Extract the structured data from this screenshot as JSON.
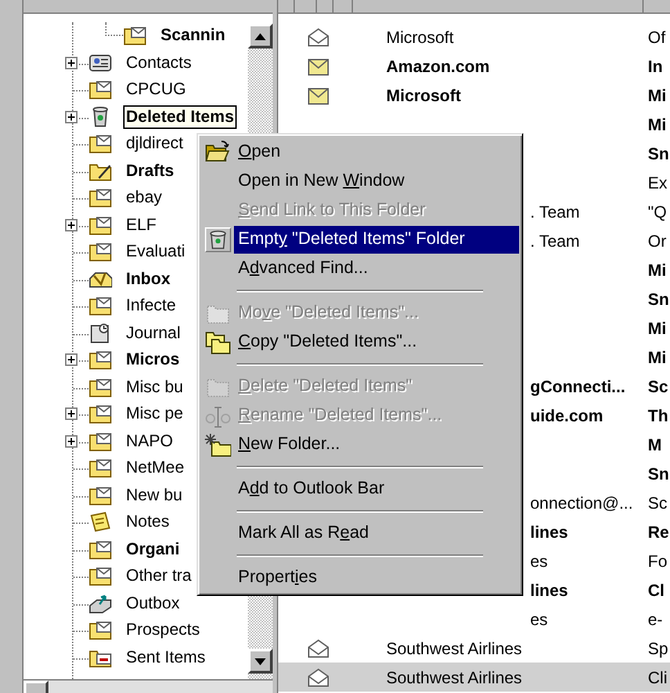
{
  "folder_tree": {
    "items": [
      {
        "children": [
          {
            "label": "Scannin",
            "bold": true,
            "expandable": false,
            "selected": false,
            "kind": "mail"
          }
        ]
      },
      {
        "label": "Contacts",
        "bold": false,
        "expandable": true,
        "selected": false,
        "kind": "contacts"
      },
      {
        "label": "CPCUG",
        "bold": false,
        "expandable": false,
        "selected": false,
        "kind": "mail"
      },
      {
        "label": "Deleted Items",
        "bold": true,
        "expandable": true,
        "selected": true,
        "kind": "trash"
      },
      {
        "label": "djldirect",
        "bold": false,
        "expandable": false,
        "selected": false,
        "kind": "mail"
      },
      {
        "label": "Drafts",
        "bold": true,
        "expandable": false,
        "selected": false,
        "kind": "drafts"
      },
      {
        "label": "ebay",
        "bold": false,
        "expandable": false,
        "selected": false,
        "kind": "mail"
      },
      {
        "label": "ELF",
        "bold": false,
        "expandable": true,
        "selected": false,
        "kind": "mail"
      },
      {
        "label": "Evaluati",
        "bold": false,
        "expandable": false,
        "selected": false,
        "kind": "mail"
      },
      {
        "label": "Inbox",
        "bold": true,
        "expandable": false,
        "selected": false,
        "kind": "inbox"
      },
      {
        "label": "Infecte",
        "bold": false,
        "expandable": false,
        "selected": false,
        "kind": "mail"
      },
      {
        "label": "Journal",
        "bold": false,
        "expandable": false,
        "selected": false,
        "kind": "journal"
      },
      {
        "label": "Micros",
        "bold": true,
        "expandable": true,
        "selected": false,
        "kind": "mail"
      },
      {
        "label": "Misc bu",
        "bold": false,
        "expandable": false,
        "selected": false,
        "kind": "mail"
      },
      {
        "label": "Misc pe",
        "bold": false,
        "expandable": true,
        "selected": false,
        "kind": "mail"
      },
      {
        "label": "NAPO",
        "bold": false,
        "expandable": true,
        "selected": false,
        "kind": "mail"
      },
      {
        "label": "NetMee",
        "bold": false,
        "expandable": false,
        "selected": false,
        "kind": "mail"
      },
      {
        "label": "New bu",
        "bold": false,
        "expandable": false,
        "selected": false,
        "kind": "mail"
      },
      {
        "label": "Notes",
        "bold": false,
        "expandable": false,
        "selected": false,
        "kind": "notes"
      },
      {
        "label": "Organi",
        "bold": true,
        "expandable": false,
        "selected": false,
        "kind": "mail"
      },
      {
        "label": "Other tra",
        "bold": false,
        "expandable": false,
        "selected": false,
        "kind": "mail"
      },
      {
        "label": "Outbox",
        "bold": false,
        "expandable": false,
        "selected": false,
        "kind": "outbox"
      },
      {
        "label": "Prospects",
        "bold": false,
        "expandable": false,
        "selected": false,
        "kind": "mail"
      },
      {
        "label": "Sent Items",
        "bold": false,
        "expandable": false,
        "selected": false,
        "kind": "sent"
      }
    ]
  },
  "messages": {
    "rows": [
      {
        "kind": "plain",
        "from": "Microsoft",
        "subject": "Of",
        "unread": false,
        "selected": false
      },
      {
        "kind": "plain",
        "from": "Amazon.com",
        "subject": "In",
        "unread": true,
        "selected": false
      },
      {
        "kind": "plain",
        "from": "Microsoft",
        "subject": "Mi",
        "unread": true,
        "selected": false
      },
      {
        "kind": "covered",
        "subject": "Mi",
        "unread": true,
        "selected": false
      },
      {
        "kind": "covered",
        "subject": "Sn",
        "unread": true,
        "selected": false
      },
      {
        "kind": "covered",
        "subject": "Ex",
        "unread": false,
        "selected": false
      },
      {
        "kind": "partly-covered",
        "from": ". Team",
        "subject": "\"Q",
        "unread": false,
        "selected": false
      },
      {
        "kind": "partly-covered",
        "from": ". Team",
        "subject": "Or",
        "unread": false,
        "selected": false
      },
      {
        "kind": "covered",
        "subject": "Mi",
        "unread": true,
        "selected": false
      },
      {
        "kind": "covered",
        "subject": "Sn",
        "unread": true,
        "selected": false
      },
      {
        "kind": "covered",
        "subject": "Mi",
        "unread": true,
        "selected": false
      },
      {
        "kind": "covered",
        "subject": "Mi",
        "unread": true,
        "selected": false
      },
      {
        "kind": "partly-covered",
        "from": "gConnecti...",
        "subject": "Sc",
        "unread": true,
        "selected": false
      },
      {
        "kind": "partly-covered",
        "from": "uide.com",
        "subject": "Th",
        "unread": true,
        "selected": false
      },
      {
        "kind": "covered",
        "subject": "M",
        "unread": true,
        "selected": false
      },
      {
        "kind": "covered",
        "subject": "Sn",
        "unread": true,
        "selected": false
      },
      {
        "kind": "partly-covered",
        "from": "onnection@...",
        "subject": "Sc",
        "unread": false,
        "selected": false
      },
      {
        "kind": "partly-covered",
        "from": "lines",
        "subject": "Re",
        "unread": true,
        "selected": false
      },
      {
        "kind": "partly-covered",
        "from": "es",
        "subject": "Fo",
        "unread": false,
        "selected": false
      },
      {
        "kind": "partly-covered",
        "from": "lines",
        "subject": "Cl",
        "unread": true,
        "selected": false
      },
      {
        "kind": "partly-covered",
        "from": "es",
        "subject": "e-",
        "unread": false,
        "selected": false
      },
      {
        "kind": "plain",
        "from": "Southwest Airlines",
        "subject": "Sp",
        "unread": false,
        "selected": false
      },
      {
        "kind": "plain",
        "from": "Southwest Airlines",
        "subject": "Cli",
        "unread": false,
        "selected": true
      }
    ]
  },
  "context_menu": {
    "items": [
      {
        "kind": "open-folder",
        "key": "O",
        "after": "pen",
        "disabled": false,
        "selected": false
      },
      {
        "kind": "text",
        "before": "Open in New ",
        "key": "W",
        "after": "indow",
        "disabled": false,
        "selected": false
      },
      {
        "kind": "text",
        "key": "S",
        "after": "end Link to This Folder",
        "disabled": true,
        "selected": false
      },
      {
        "kind": "trash",
        "before": "Empt",
        "key": "y",
        "after": " \"Deleted Items\" Folder",
        "disabled": false,
        "selected": true
      },
      {
        "kind": "text",
        "before": "A",
        "key": "d",
        "after": "vanced Find...",
        "disabled": false,
        "selected": false
      },
      {
        "kind": "separator"
      },
      {
        "kind": "move",
        "before": "Mo",
        "key": "v",
        "after": "e \"Deleted Items\"...",
        "disabled": true,
        "selected": false
      },
      {
        "kind": "copy",
        "key": "C",
        "after": "opy \"Deleted Items\"...",
        "disabled": false,
        "selected": false
      },
      {
        "kind": "separator"
      },
      {
        "kind": "delete",
        "key": "D",
        "after": "elete \"Deleted Items\"",
        "disabled": true,
        "selected": false
      },
      {
        "kind": "rename",
        "key": "R",
        "after": "ename \"Deleted Items\"...",
        "disabled": true,
        "selected": false
      },
      {
        "kind": "new-folder",
        "key": "N",
        "after": "ew Folder...",
        "disabled": false,
        "selected": false
      },
      {
        "kind": "separator"
      },
      {
        "kind": "text",
        "before": "A",
        "key": "d",
        "after": "d to Outlook Bar",
        "disabled": false,
        "selected": false
      },
      {
        "kind": "separator"
      },
      {
        "kind": "text",
        "before": "Mark All as R",
        "key": "e",
        "after": "ad",
        "disabled": false,
        "selected": false
      },
      {
        "kind": "separator"
      },
      {
        "kind": "text",
        "before": "Propert",
        "key": "i",
        "after": "es",
        "disabled": false,
        "selected": false
      }
    ]
  }
}
